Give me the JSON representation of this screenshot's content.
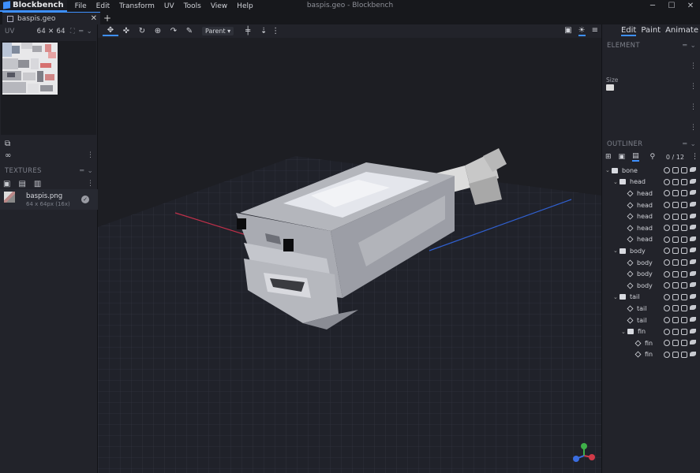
{
  "app": {
    "name": "Blockbench",
    "window_title": "baspis.geo - Blockbench",
    "menu": [
      "File",
      "Edit",
      "Transform",
      "UV",
      "Tools",
      "View",
      "Help"
    ],
    "window_controls": [
      "─",
      "☐",
      "✕"
    ]
  },
  "tabs": [
    {
      "label": "baspis.geo"
    }
  ],
  "uv_panel": {
    "title": "UV",
    "size": "64 ✕ 64"
  },
  "textures_panel": {
    "title": "TEXTURES",
    "items": [
      {
        "name": "baspis.png",
        "dims": "64 x 64px (16x)"
      }
    ]
  },
  "toolbar": {
    "pivot_mode": "Parent ▾"
  },
  "modes": [
    "Edit",
    "Paint",
    "Animate"
  ],
  "element_panel": {
    "title": "ELEMENT",
    "size_label": "Size"
  },
  "outliner": {
    "title": "OUTLINER",
    "count": "0 / 12",
    "nodes": [
      {
        "label": "bone",
        "type": "group",
        "depth": 0
      },
      {
        "label": "head",
        "type": "group",
        "depth": 1
      },
      {
        "label": "head",
        "type": "cube",
        "depth": 2
      },
      {
        "label": "head",
        "type": "cube",
        "depth": 2
      },
      {
        "label": "head",
        "type": "cube",
        "depth": 2
      },
      {
        "label": "head",
        "type": "cube",
        "depth": 2
      },
      {
        "label": "head",
        "type": "cube",
        "depth": 2
      },
      {
        "label": "body",
        "type": "group",
        "depth": 1
      },
      {
        "label": "body",
        "type": "cube",
        "depth": 2
      },
      {
        "label": "body",
        "type": "cube",
        "depth": 2
      },
      {
        "label": "body",
        "type": "cube",
        "depth": 2
      },
      {
        "label": "tail",
        "type": "group",
        "depth": 1
      },
      {
        "label": "tail",
        "type": "cube",
        "depth": 2
      },
      {
        "label": "tail",
        "type": "cube",
        "depth": 2
      },
      {
        "label": "fin",
        "type": "group",
        "depth": 2
      },
      {
        "label": "fin",
        "type": "cube",
        "depth": 3
      },
      {
        "label": "fin",
        "type": "cube",
        "depth": 3
      }
    ]
  },
  "colors": {
    "accent": "#3e90ff",
    "background": "#1e1f24",
    "panel": "#22232a"
  }
}
